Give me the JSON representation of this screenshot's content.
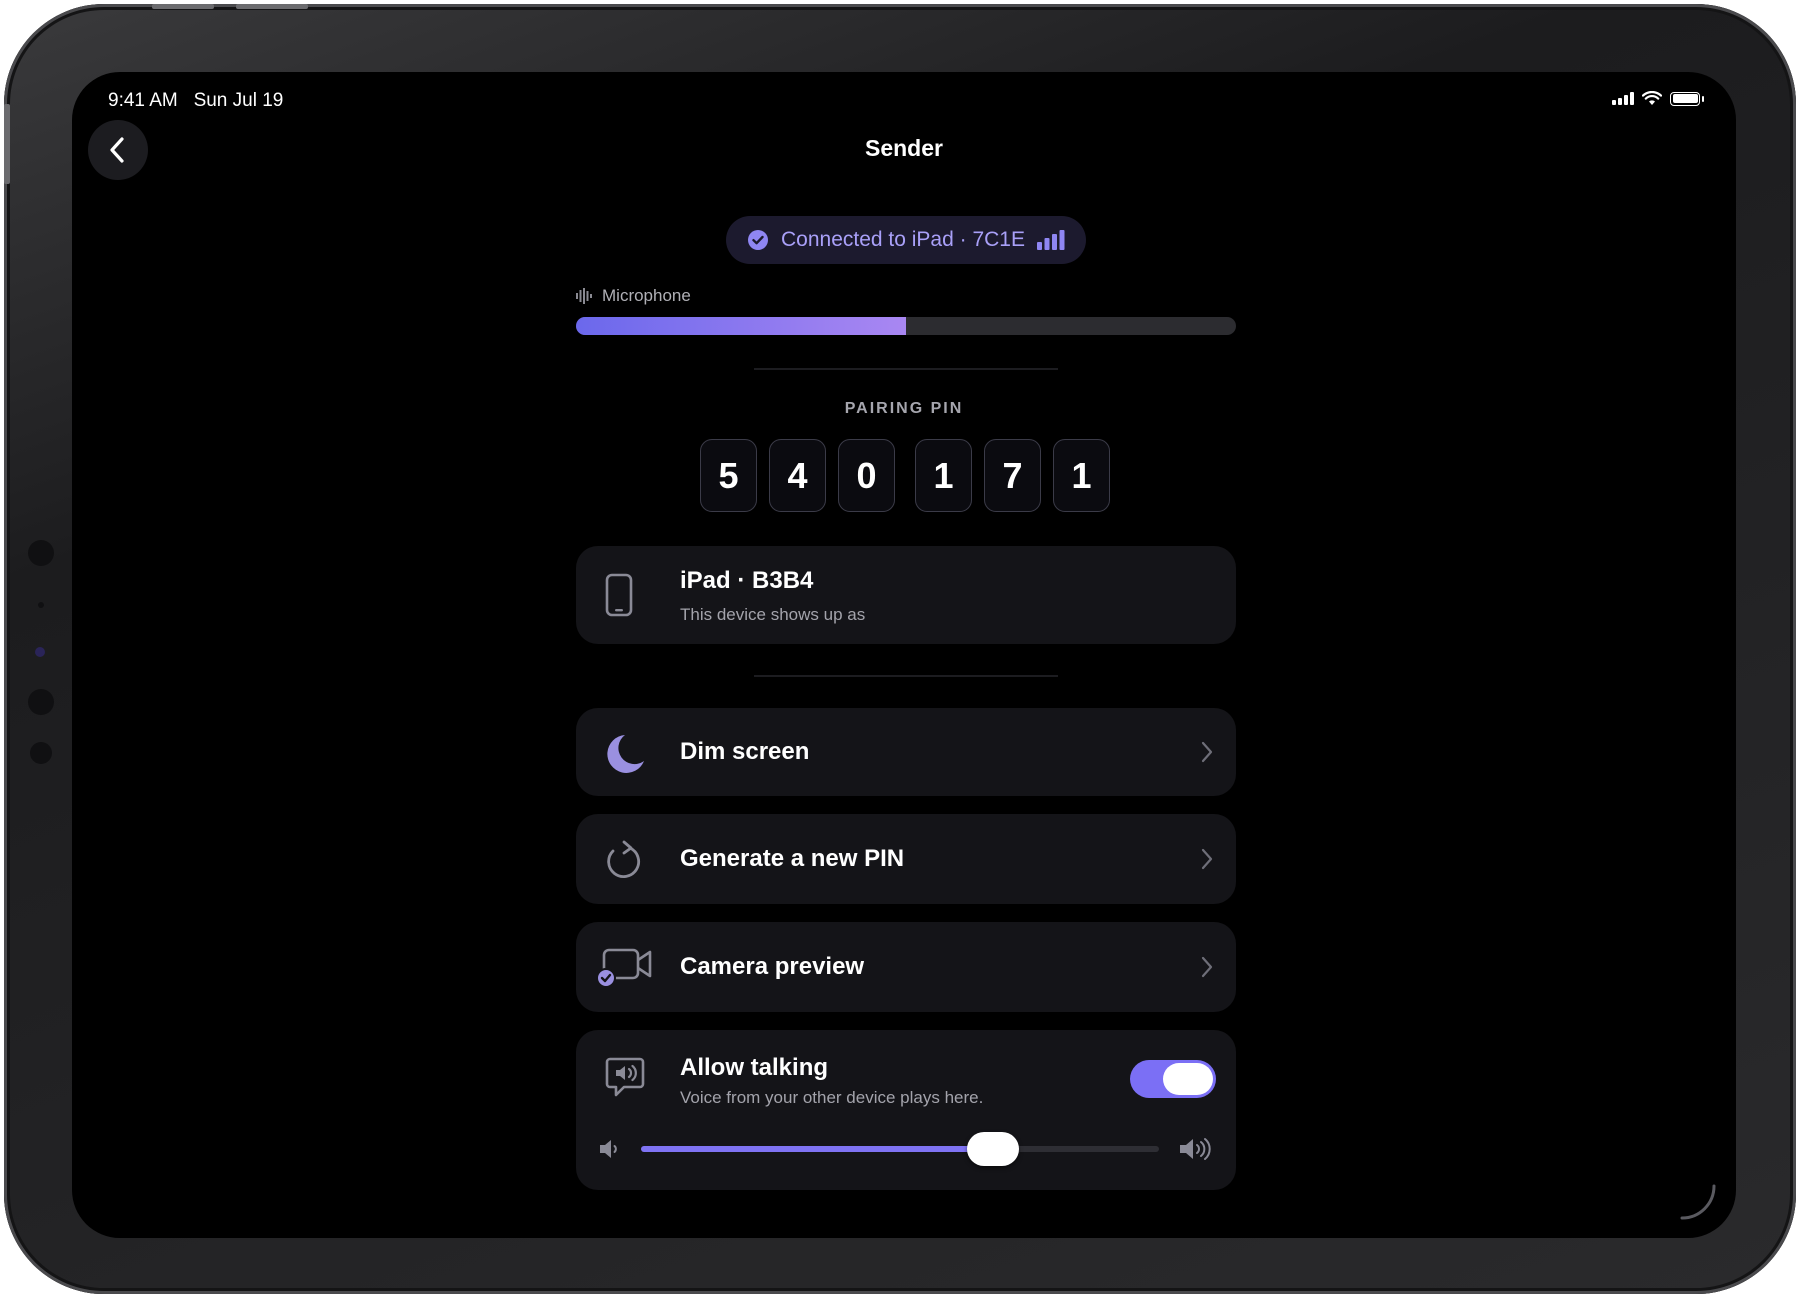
{
  "status_bar": {
    "time": "9:41 AM",
    "date": "Sun Jul 19",
    "icons": [
      "cellular-signal-icon",
      "wifi-icon",
      "battery-icon"
    ]
  },
  "nav": {
    "title": "Sender",
    "back_icon": "chevron-left-icon"
  },
  "connection": {
    "label": "Connected to iPad · 7C1E",
    "icon": "checkmark-circle-icon",
    "signal_icon": "signal-bars-icon",
    "color": "#a9a0f8"
  },
  "microphone": {
    "label": "Microphone",
    "level_percent": 50,
    "colors": [
      "#6b68ec",
      "#a987f2"
    ]
  },
  "pairing": {
    "label": "PAIRING PIN",
    "digits": [
      "5",
      "4",
      "0",
      "1",
      "7",
      "1"
    ]
  },
  "device": {
    "name": "iPad · B3B4",
    "subtitle": "This device shows up as",
    "icon": "phone-icon"
  },
  "actions": [
    {
      "label": "Dim screen",
      "icon": "moon-icon"
    },
    {
      "label": "Generate a new PIN",
      "icon": "refresh-icon"
    },
    {
      "label": "Camera preview",
      "icon": "video-camera-check-icon"
    }
  ],
  "talk": {
    "title": "Allow talking",
    "subtitle": "Voice from your other device plays here.",
    "enabled": true,
    "volume_percent": 68,
    "icon": "speaker-bubble-icon",
    "accent": "#7b6ff5"
  }
}
